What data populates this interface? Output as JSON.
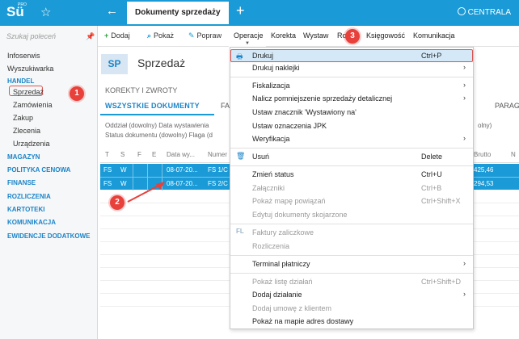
{
  "app": {
    "logo": "Sü",
    "logo_sup": "PRO",
    "document_tab": "Dokumenty sprzedaży",
    "branch": "CENTRALA"
  },
  "sidebar": {
    "search_placeholder": "Szukaj poleceń",
    "top_items": [
      "Infoserwis",
      "Wyszukiwarka"
    ],
    "handel": {
      "label": "HANDEL",
      "items": [
        "Sprzedaż",
        "Zamówienia",
        "Zakup",
        "Zlecenia",
        "Urządzenia"
      ]
    },
    "sections": [
      "MAGAZYN",
      "POLITYKA CENOWA",
      "FINANSE",
      "ROZLICZENIA",
      "KARTOTEKI",
      "KOMUNIKACJA",
      "EWIDENCJE DODATKOWE"
    ]
  },
  "toolbar": {
    "dodaj": "Dodaj",
    "pokaz": "Pokaż",
    "popraw": "Popraw"
  },
  "menubar": [
    "Operacje",
    "Korekta",
    "Wystaw",
    "Ro",
    "Księgowość",
    "Komunikacja"
  ],
  "content": {
    "badge": "SP",
    "title": "Sprzedaż",
    "korekty": "KOREKTY I ZWROTY",
    "tab_all": "WSZYSTKIE DOKUMENTY",
    "tab_fa": "FA",
    "tab_para": "PARAG",
    "filter1": "Oddział (dowolny)   Data wystawienia",
    "filter2": "Status dokumentu (dowolny)   Flaga (d",
    "filter_right": "olny)"
  },
  "table": {
    "headers": [
      "T",
      "S",
      "F",
      "E",
      "Data wy...",
      "Numer",
      "Brutto",
      "N"
    ],
    "rows": [
      {
        "t": "FS",
        "s": "W",
        "date": "08-07-20...",
        "numer": "FS 1/C",
        "brutto": "425,46"
      },
      {
        "t": "FS",
        "s": "W",
        "date": "08-07-20...",
        "numer": "FS 2/C",
        "brutto": "294,53"
      }
    ]
  },
  "dropdown": {
    "items": [
      {
        "label": "Drukuj",
        "shortcut": "Ctrl+P",
        "icon": "printer-icon"
      },
      {
        "label": "Drukuj naklejki",
        "submenu": true
      },
      {
        "label": "Fiskalizacja",
        "submenu": true
      },
      {
        "label": "Nalicz pomniejszenie sprzedaży detalicznej",
        "submenu": true
      },
      {
        "label": "Ustaw znacznik 'Wystawiony na'"
      },
      {
        "label": "Ustaw oznaczenia JPK"
      },
      {
        "label": "Weryfikacja",
        "submenu": true
      },
      {
        "label": "Usuń",
        "shortcut": "Delete",
        "icon": "trash-icon"
      },
      {
        "label": "Zmień status",
        "shortcut": "Ctrl+U"
      },
      {
        "label": "Załączniki",
        "shortcut": "Ctrl+B",
        "disabled": true
      },
      {
        "label": "Pokaż mapę powiązań",
        "shortcut": "Ctrl+Shift+X",
        "disabled": true
      },
      {
        "label": "Edytuj dokumenty skojarzone",
        "disabled": true
      },
      {
        "label": "Faktury zaliczkowe",
        "disabled": true,
        "icon_text": "FL"
      },
      {
        "label": "Rozliczenia",
        "disabled": true
      },
      {
        "label": "Terminal płatniczy",
        "submenu": true
      },
      {
        "label": "Pokaż listę działań",
        "shortcut": "Ctrl+Shift+D",
        "disabled": true
      },
      {
        "label": "Dodaj działanie",
        "submenu": true
      },
      {
        "label": "Dodaj umowę z klientem",
        "disabled": true
      },
      {
        "label": "Pokaż na mapie adres dostawy"
      }
    ]
  },
  "annotations": [
    "1",
    "2",
    "3"
  ],
  "colors": {
    "accent": "#1a9ad6",
    "annotation": "#e8403a"
  }
}
